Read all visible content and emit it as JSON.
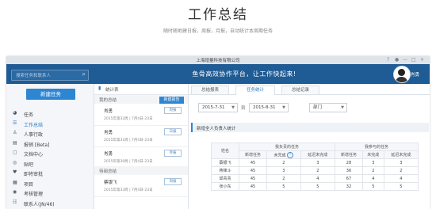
{
  "hero": {
    "title": "工作总结",
    "subtitle": "随时随地建日报，周报，月报，自动统计本周期任务"
  },
  "window": {
    "title": "上海增量科技有限公司",
    "controls": [
      "?",
      "●",
      "—",
      "□",
      "×"
    ]
  },
  "topbar": {
    "search_placeholder": "搜索任务和联系人",
    "slogan": "鱼骨高效协作平台，让工作快起来!",
    "user_name": "肖勇"
  },
  "sidebar": {
    "new_task_label": "新建任务",
    "items": [
      {
        "label": "任务",
        "icon": "clock-icon",
        "glyph": "◕"
      },
      {
        "label": "工作总结",
        "icon": "document-icon",
        "glyph": "☰",
        "active": true
      },
      {
        "label": "人事行政",
        "icon": "person-icon",
        "glyph": "♙"
      },
      {
        "label": "报销 [Beta]",
        "icon": "receipt-icon",
        "glyph": "▤"
      },
      {
        "label": "文档中心",
        "icon": "folder-icon",
        "glyph": "▢"
      },
      {
        "label": "贴吧",
        "icon": "chat-icon",
        "glyph": "◎"
      },
      {
        "label": "即将审批",
        "icon": "heart-icon",
        "glyph": "♥"
      },
      {
        "label": "项目",
        "icon": "project-icon",
        "glyph": "▦"
      },
      {
        "label": "考核管理",
        "icon": "target-icon",
        "glyph": "◉"
      },
      {
        "label": "联系人(JN/46)",
        "icon": "contacts-icon",
        "glyph": "☷"
      }
    ]
  },
  "mid": {
    "header": "统计表",
    "my_summary_label": "我的总结",
    "new_report_label": "新建报告",
    "received_label": "待阅总结",
    "items": [
      {
        "name": "肖勇",
        "date": "2015年第32周 | 7月4日-23日",
        "tag": "周报"
      },
      {
        "name": "肖勇",
        "date": "2015年第31周 | 7月4日-23日",
        "tag": "日报"
      },
      {
        "name": "肖勇",
        "date": "2015年第30周 | 7月4日-23日",
        "tag": "月报"
      }
    ],
    "received_items": [
      {
        "name": "蔡银飞",
        "date": "2015年第33周 | 7月4日-23日",
        "tag": "周报"
      }
    ]
  },
  "main": {
    "tabs": [
      "总结报表",
      "任务统计",
      "总结记录"
    ],
    "active_tab": 1,
    "date_from": "2015-7-31",
    "to_label": "到",
    "date_to": "2015-8-31",
    "dept_label": "部门",
    "panel_title": "新增全人负责人统计",
    "table": {
      "col_name": "姓名",
      "group1": "我负责的任务",
      "group2": "我参与的任务",
      "sub1": [
        "新增任务",
        "未完成",
        "延迟未完成"
      ],
      "sub2": [
        "新增任务",
        "未完成",
        "延迟未完成"
      ],
      "help_glyph": "?",
      "rows": [
        {
          "name": "蔡银飞",
          "v": [
            "45",
            "2",
            "3",
            "28",
            "3",
            "3"
          ]
        },
        {
          "name": "蒋锋斗",
          "v": [
            "45",
            "3",
            "2",
            "36",
            "2",
            "2"
          ]
        },
        {
          "name": "邱青青",
          "v": [
            "45",
            "2",
            "4",
            "67",
            "4",
            "4"
          ]
        },
        {
          "name": "张小东",
          "v": [
            "45",
            "5",
            "5",
            "32",
            "5",
            "5"
          ]
        }
      ]
    }
  },
  "colors": {
    "topbar": "#1f5b94",
    "accent": "#2e86d3",
    "active_text": "#2e7ac2"
  }
}
